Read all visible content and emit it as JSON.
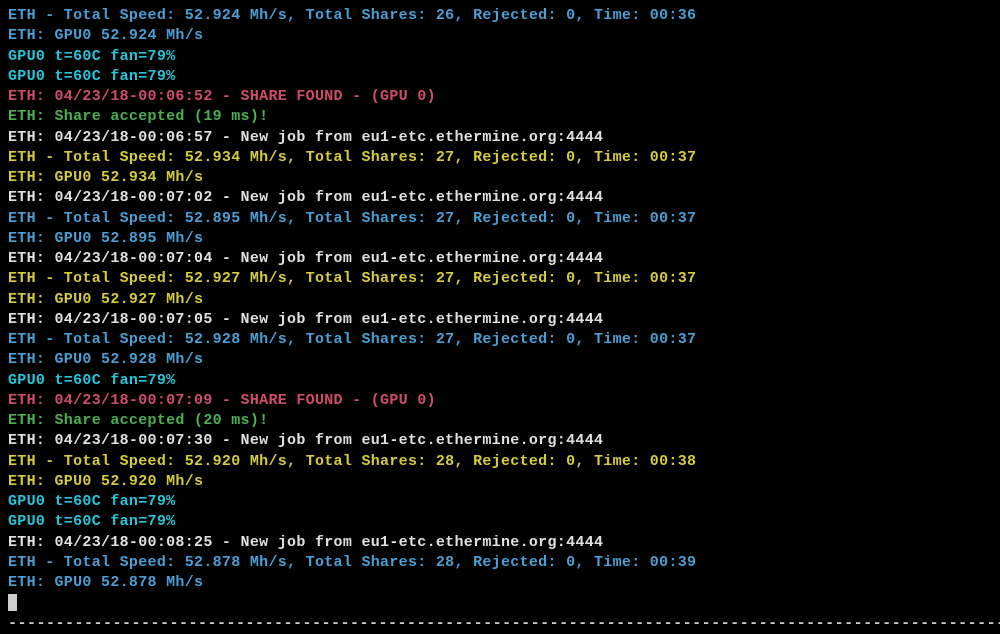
{
  "colors": {
    "blue": "#4a9fd4",
    "cyan": "#26c6da",
    "magenta": "#d14b6e",
    "green": "#4caf50",
    "white": "#e0e0e0",
    "yellow": "#d4cc3a"
  },
  "lines": [
    {
      "color": "blue",
      "text": "ETH - Total Speed: 52.924 Mh/s, Total Shares: 26, Rejected: 0, Time: 00:36"
    },
    {
      "color": "blue",
      "text": "ETH: GPU0 52.924 Mh/s"
    },
    {
      "color": "cyan",
      "text": "GPU0 t=60C fan=79%"
    },
    {
      "color": "cyan",
      "text": "GPU0 t=60C fan=79%"
    },
    {
      "color": "magenta",
      "text": "ETH: 04/23/18-00:06:52 - SHARE FOUND - (GPU 0)"
    },
    {
      "color": "green",
      "text": "ETH: Share accepted (19 ms)!"
    },
    {
      "color": "white",
      "text": "ETH: 04/23/18-00:06:57 - New job from eu1-etc.ethermine.org:4444"
    },
    {
      "color": "yellow",
      "text": "ETH - Total Speed: 52.934 Mh/s, Total Shares: 27, Rejected: 0, Time: 00:37"
    },
    {
      "color": "yellow",
      "text": "ETH: GPU0 52.934 Mh/s"
    },
    {
      "color": "white",
      "text": "ETH: 04/23/18-00:07:02 - New job from eu1-etc.ethermine.org:4444"
    },
    {
      "color": "blue",
      "text": "ETH - Total Speed: 52.895 Mh/s, Total Shares: 27, Rejected: 0, Time: 00:37"
    },
    {
      "color": "blue",
      "text": "ETH: GPU0 52.895 Mh/s"
    },
    {
      "color": "white",
      "text": "ETH: 04/23/18-00:07:04 - New job from eu1-etc.ethermine.org:4444"
    },
    {
      "color": "yellow",
      "text": "ETH - Total Speed: 52.927 Mh/s, Total Shares: 27, Rejected: 0, Time: 00:37"
    },
    {
      "color": "yellow",
      "text": "ETH: GPU0 52.927 Mh/s"
    },
    {
      "color": "white",
      "text": "ETH: 04/23/18-00:07:05 - New job from eu1-etc.ethermine.org:4444"
    },
    {
      "color": "blue",
      "text": "ETH - Total Speed: 52.928 Mh/s, Total Shares: 27, Rejected: 0, Time: 00:37"
    },
    {
      "color": "blue",
      "text": "ETH: GPU0 52.928 Mh/s"
    },
    {
      "color": "cyan",
      "text": "GPU0 t=60C fan=79%"
    },
    {
      "color": "magenta",
      "text": "ETH: 04/23/18-00:07:09 - SHARE FOUND - (GPU 0)"
    },
    {
      "color": "green",
      "text": "ETH: Share accepted (20 ms)!"
    },
    {
      "color": "white",
      "text": "ETH: 04/23/18-00:07:30 - New job from eu1-etc.ethermine.org:4444"
    },
    {
      "color": "yellow",
      "text": "ETH - Total Speed: 52.920 Mh/s, Total Shares: 28, Rejected: 0, Time: 00:38"
    },
    {
      "color": "yellow",
      "text": "ETH: GPU0 52.920 Mh/s"
    },
    {
      "color": "cyan",
      "text": "GPU0 t=60C fan=79%"
    },
    {
      "color": "cyan",
      "text": "GPU0 t=60C fan=79%"
    },
    {
      "color": "white",
      "text": "ETH: 04/23/18-00:08:25 - New job from eu1-etc.ethermine.org:4444"
    },
    {
      "color": "blue",
      "text": "ETH - Total Speed: 52.878 Mh/s, Total Shares: 28, Rejected: 0, Time: 00:39"
    },
    {
      "color": "blue",
      "text": "ETH: GPU0 52.878 Mh/s"
    }
  ],
  "separator": "----------------------------------------------------------------------------------------------------------"
}
